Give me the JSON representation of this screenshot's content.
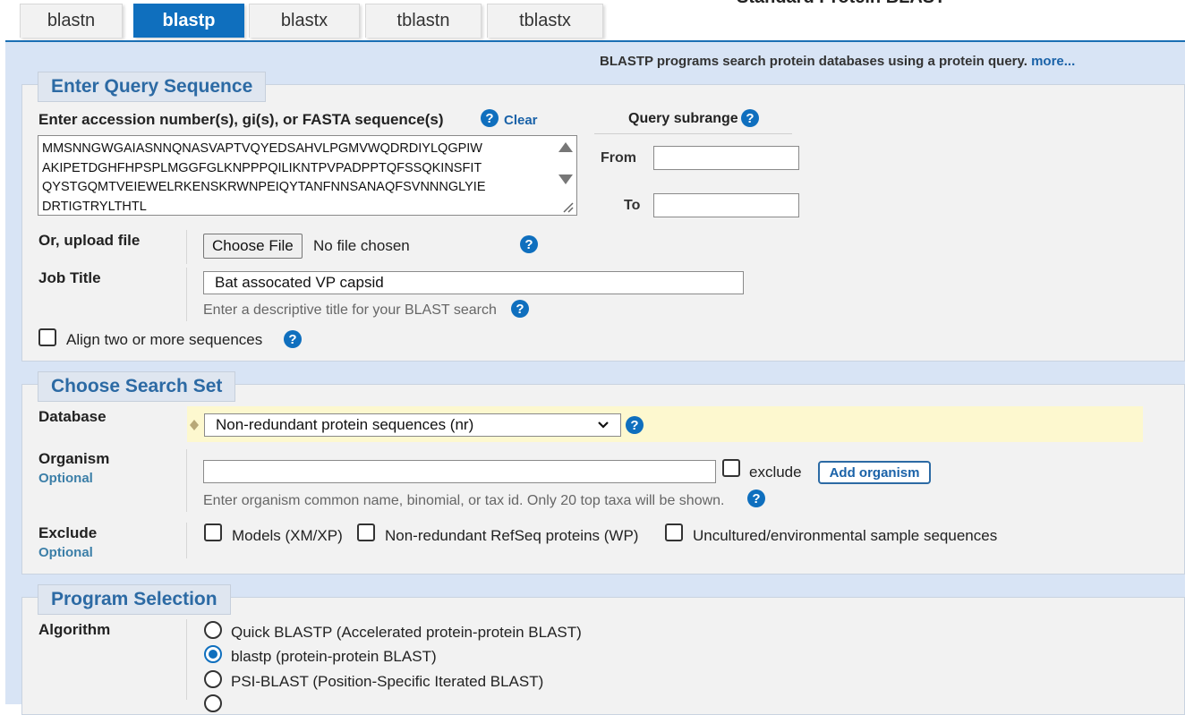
{
  "page_title": "Standard Protein BLAST",
  "tabs": [
    {
      "label": "blastn"
    },
    {
      "label": "blastp"
    },
    {
      "label": "blastx"
    },
    {
      "label": "tblastn"
    },
    {
      "label": "tblastx"
    }
  ],
  "active_tab": "blastp",
  "description": "BLASTP programs search protein databases using a protein query.",
  "more_link": "more...",
  "query": {
    "section_title": "Enter Query Sequence",
    "label": "Enter accession number(s), gi(s), or FASTA sequence(s)",
    "clear": "Clear",
    "sequence_lines": [
      "MMSNNGWGAIASNNQNASVAPTVQYEDSAHVLPGMVWQDRDIYLQGPIW",
      "AKIPETDGHFHPSPLMGGFGLKNPPPQILIKNTPVPADPPTQFSSQKINSFIT",
      "QYSTGQMTVEIEWELRKENSKRWNPEIQYTANFNNSANAQFSVNNNGLYIE",
      "DRTIGTRYLTHTL"
    ],
    "subrange_title": "Query subrange",
    "from_label": "From",
    "to_label": "To",
    "from_value": "",
    "to_value": "",
    "upload_label": "Or, upload file",
    "choose_file": "Choose File",
    "no_file": "No file chosen",
    "job_title_label": "Job Title",
    "job_title_value": "Bat assocated VP capsid",
    "job_title_hint": "Enter a descriptive title for your BLAST search",
    "align_label": "Align two or more sequences"
  },
  "search_set": {
    "section_title": "Choose Search Set",
    "database_label": "Database",
    "database_value": "Non-redundant protein sequences (nr)",
    "organism_label": "Organism",
    "optional": "Optional",
    "organism_value": "",
    "exclude_label": "exclude",
    "add_organism": "Add organism",
    "organism_hint": "Enter organism common name, binomial, or tax id. Only 20 top taxa will be shown.",
    "exclude_section_label": "Exclude",
    "exclude_options": [
      {
        "label": "Models (XM/XP)"
      },
      {
        "label": "Non-redundant RefSeq proteins (WP)"
      },
      {
        "label": "Uncultured/environmental sample sequences"
      }
    ]
  },
  "program": {
    "section_title": "Program Selection",
    "algorithm_label": "Algorithm",
    "options": [
      {
        "label": "Quick BLASTP (Accelerated protein-protein BLAST)",
        "checked": false
      },
      {
        "label": "blastp (protein-protein BLAST)",
        "checked": true
      },
      {
        "label": "PSI-BLAST (Position-Specific Iterated BLAST)",
        "checked": false
      }
    ]
  },
  "colors": {
    "accent": "#0f6fbe",
    "band": "#d8e4f5",
    "section_bg": "#f2f2f2",
    "highlight": "#fdf8cf"
  },
  "icons": [
    "help-icon",
    "dropdown-chevron-icon",
    "scroll-up-icon",
    "scroll-down-icon",
    "resize-grip-icon",
    "diamond-icon"
  ]
}
